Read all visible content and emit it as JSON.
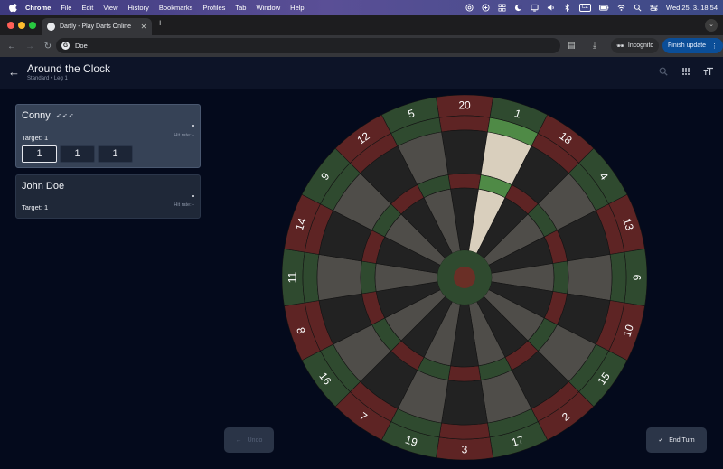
{
  "menubar": {
    "app_name": "Chrome",
    "items": [
      "File",
      "Edit",
      "View",
      "History",
      "Bookmarks",
      "Profiles",
      "Tab",
      "Window",
      "Help"
    ],
    "kbd_badge": "CZ",
    "clock": "Wed 25. 3.  18:54"
  },
  "browser": {
    "tab_title": "Dartly - Play Darts Online",
    "address": "Doe",
    "incognito_label": "Incognito",
    "finish_update_label": "Finish update"
  },
  "app": {
    "title": "Around the Clock",
    "subtitle": "Standard • Leg 1",
    "players": [
      {
        "name": "Conny",
        "darts": "🎯🎯🎯",
        "target_label": "Target: 1",
        "hit_rate_label": "Hit rate: -",
        "throws": [
          "1",
          "1",
          "1"
        ],
        "active": true
      },
      {
        "name": "John Doe",
        "target_label": "Target: 1",
        "hit_rate_label": "Hit rate: -",
        "active": false
      }
    ],
    "undo_label": "Undo",
    "end_turn_label": "End Turn"
  },
  "dartboard": {
    "numbers": [
      20,
      1,
      18,
      4,
      13,
      6,
      10,
      15,
      2,
      17,
      3,
      19,
      7,
      16,
      8,
      11,
      14,
      9,
      12,
      5
    ],
    "highlighted_segment": 1,
    "colors": {
      "board_dark": "#222222",
      "board_light": "#4f4d49",
      "ring_red": "#5e2424",
      "ring_green": "#2f4a2f",
      "ring_rim_red": "#5e2424",
      "highlight_light": "#d9cfbd",
      "highlight_green": "#4f8a46",
      "bull_outer": "#2f4a2f",
      "bull_inner": "#6a2f26",
      "number_text": "#ffffff"
    }
  }
}
